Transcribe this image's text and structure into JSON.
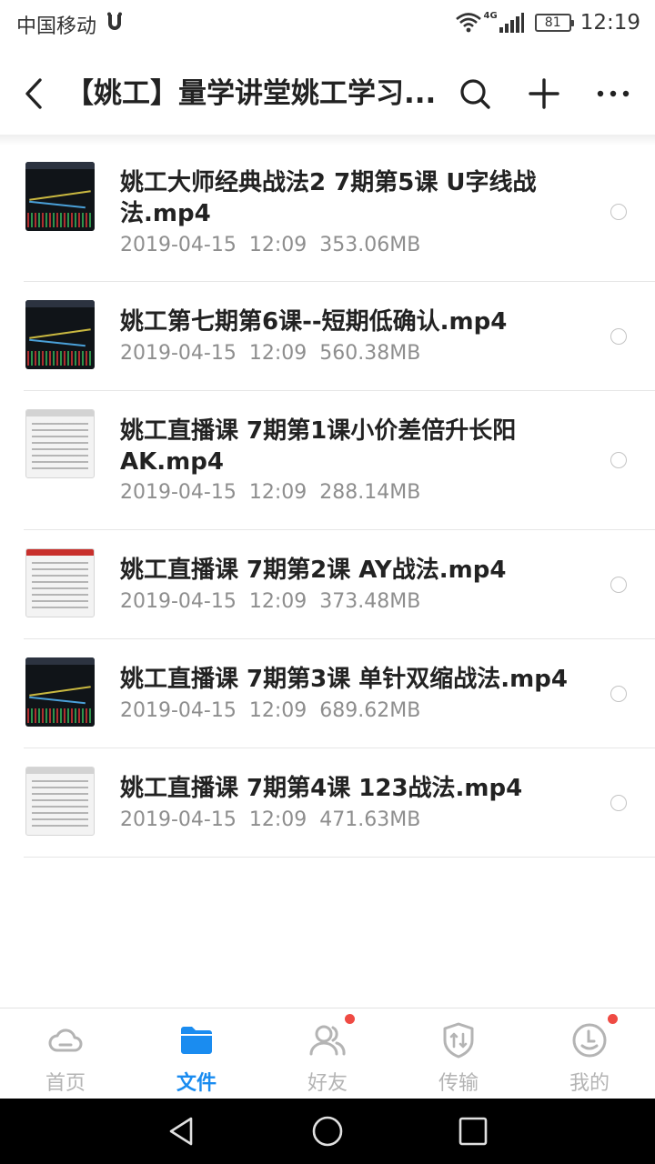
{
  "status_bar": {
    "carrier": "中国移动",
    "network_type": "4G",
    "battery": "81",
    "time": "12:19",
    "icons": [
      "notification-icon",
      "wifi-icon",
      "signal-icon",
      "battery-icon"
    ]
  },
  "header": {
    "title": "【姚工】量学讲堂姚工学习...",
    "icons": [
      "back-arrow-icon",
      "search-icon",
      "plus-icon",
      "more-dots-icon"
    ]
  },
  "files": [
    {
      "name": "姚工大师经典战法2 7期第5课 U字线战法.mp4",
      "date": "2019-04-15",
      "time": "12:09",
      "size": "353.06MB",
      "thumbnail": "stock-chart"
    },
    {
      "name": "姚工第七期第6课--短期低确认.mp4",
      "date": "2019-04-15",
      "time": "12:09",
      "size": "560.38MB",
      "thumbnail": "stock-chart"
    },
    {
      "name": "姚工直播课 7期第1课小价差倍升长阳AK.mp4",
      "date": "2019-04-15",
      "time": "12:09",
      "size": "288.14MB",
      "thumbnail": "document"
    },
    {
      "name": "姚工直播课 7期第2课 AY战法.mp4",
      "date": "2019-04-15",
      "time": "12:09",
      "size": "373.48MB",
      "thumbnail": "document-red-header"
    },
    {
      "name": "姚工直播课 7期第3课 单针双缩战法.mp4",
      "date": "2019-04-15",
      "time": "12:09",
      "size": "689.62MB",
      "thumbnail": "stock-chart"
    },
    {
      "name": "姚工直播课 7期第4课 123战法.mp4",
      "date": "2019-04-15",
      "time": "12:09",
      "size": "471.63MB",
      "thumbnail": "document"
    }
  ],
  "bottom_nav": [
    {
      "label": "首页",
      "icon": "cloud-icon",
      "active": false,
      "badge": false
    },
    {
      "label": "文件",
      "icon": "folder-icon",
      "active": true,
      "badge": false
    },
    {
      "label": "好友",
      "icon": "friends-icon",
      "active": false,
      "badge": true
    },
    {
      "label": "传输",
      "icon": "transfer-shield-icon",
      "active": false,
      "badge": false
    },
    {
      "label": "我的",
      "icon": "profile-face-icon",
      "active": false,
      "badge": true
    }
  ],
  "colors": {
    "accent": "#1a8cf0",
    "badge": "#ef4a43",
    "inactive": "#b4b4b4",
    "meta_text": "#8e8e8e"
  }
}
